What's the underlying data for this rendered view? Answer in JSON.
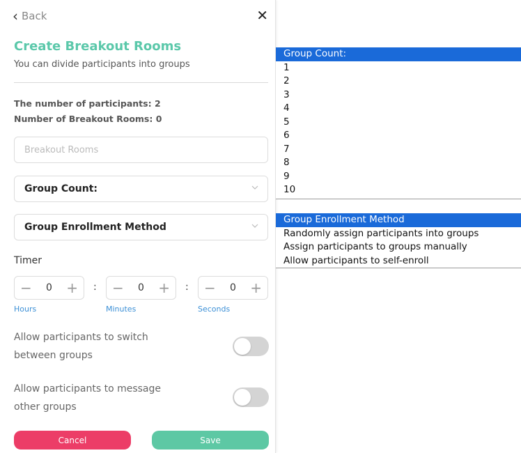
{
  "header": {
    "back_label": "Back"
  },
  "title": "Create Breakout Rooms",
  "subtitle": "You can divide participants into groups",
  "stats": {
    "participants": "The number of participants: 2",
    "rooms": "Number of Breakout Rooms: 0"
  },
  "breakout_input": {
    "placeholder": "Breakout Rooms",
    "value": ""
  },
  "group_count_select": {
    "label": "Group Count:"
  },
  "enrollment_select": {
    "label": "Group Enrollment Method"
  },
  "timer": {
    "label": "Timer",
    "hours": {
      "value": "0",
      "unit": "Hours"
    },
    "minutes": {
      "value": "0",
      "unit": "Minutes"
    },
    "seconds": {
      "value": "0",
      "unit": "Seconds"
    },
    "separator": ":",
    "minus": "−",
    "plus": "+"
  },
  "toggles": {
    "switch_groups": {
      "label": "Allow participants to switch between groups",
      "on": false
    },
    "message_groups": {
      "label": "Allow participants to message other groups",
      "on": false
    }
  },
  "buttons": {
    "cancel": "Cancel",
    "save": "Save"
  },
  "group_count_options": [
    "Group Count:",
    "1",
    "2",
    "3",
    "4",
    "5",
    "6",
    "7",
    "8",
    "9",
    "10"
  ],
  "enrollment_options": [
    "Group Enrollment Method",
    "Randomly assign participants into groups",
    "Assign participants to groups manually",
    "Allow participants to self-enroll"
  ],
  "colors": {
    "accent": "#5bc8aa",
    "cancel": "#ec3d67",
    "save": "#5dc8a4",
    "selection": "#1a6ad9",
    "unit_label": "#3b8fd6"
  }
}
